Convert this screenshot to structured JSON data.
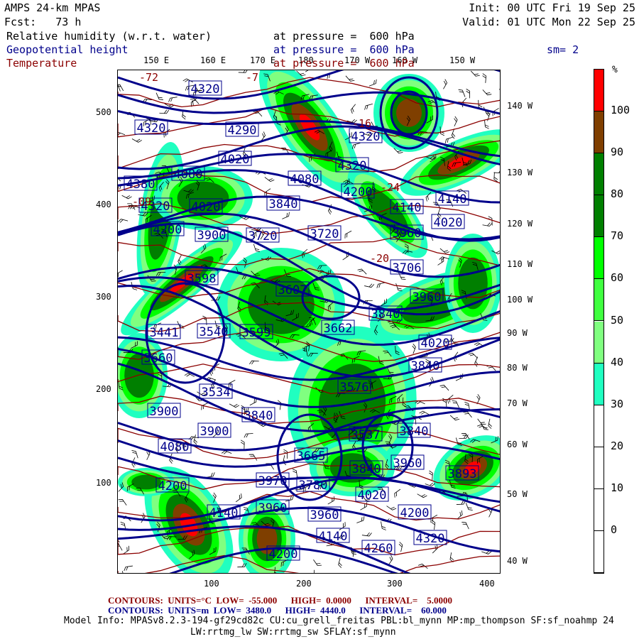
{
  "header": {
    "model": "AMPS 24-km MPAS",
    "fcst": "Fcst:   73 h",
    "init": "Init: 00 UTC Fri 19 Sep 25",
    "valid": "Valid: 01 UTC Mon 22 Sep 25",
    "field1": "Relative humidity (w.r.t. water)",
    "field1_level": "at pressure =  600 hPa",
    "field2": "Geopotential height",
    "field2_level": "at pressure =  600 hPa",
    "smoothing": "sm= 2",
    "field3": "Temperature",
    "field3_level": "at pressure =  600 hPa"
  },
  "map": {
    "top_lon_labels": [
      "150 E",
      "160 E",
      "170 E",
      "180",
      "170 W",
      "160 W",
      "150 W"
    ],
    "right_lon_labels": [
      "140 W",
      "130 W",
      "120 W",
      "110 W",
      "100 W",
      "90 W",
      "80 W",
      "70 W",
      "60 W",
      "50 W",
      "40 W"
    ],
    "x_ticks": [
      "100",
      "200",
      "300",
      "400"
    ],
    "y_ticks": [
      "500",
      "400",
      "300",
      "200",
      "100"
    ],
    "height_labels": [
      "4320",
      "4320",
      "4290",
      "4020",
      "4080",
      "4380",
      "4320",
      "4020",
      "4200",
      "3900",
      "3720",
      "4080",
      "3840",
      "4320",
      "4320",
      "4200",
      "4140",
      "4140",
      "4020",
      "3960",
      "3720",
      "3706",
      "3960",
      "3840",
      "3607",
      "3598",
      "3441",
      "3540",
      "3599",
      "3662",
      "4020",
      "3660",
      "3840",
      "3534",
      "3576",
      "3900",
      "3840",
      "3900",
      "4080",
      "3537",
      "3840",
      "3665",
      "3840",
      "3960",
      "3893",
      "4200",
      "3970",
      "3780",
      "4020",
      "4140",
      "3960",
      "3960",
      "4200",
      "4140",
      "4260",
      "4320",
      "4200"
    ],
    "temp_labels": [
      "-72",
      "-7",
      "-16",
      "-24",
      "-20",
      "-09"
    ]
  },
  "colorbar": {
    "unit": "%",
    "labels": [
      "100",
      "90",
      "80",
      "70",
      "60",
      "50",
      "40",
      "30",
      "20",
      "10",
      "0"
    ],
    "colors": [
      "#ff0000",
      "#7f3f00",
      "#007f00",
      "#007f00",
      "#00ff00",
      "#40ff40",
      "#80ff80",
      "#20ffc0",
      "#ffffff",
      "#ffffff",
      "#ffffff",
      "#ffffff"
    ]
  },
  "footer": {
    "temp_contours": "CONTOURS:  UNITS=°C  LOW=  -55.000      HIGH=  0.0000      INTERVAL=    5.0000",
    "height_contours": "CONTOURS:  UNITS=m  LOW=  3480.0      HIGH=  4440.0      INTERVAL=    60.000",
    "model_info": "Model Info: MPASv8.2.3-194-gf29cd82c CU:cu_grell_freitas PBL:bl_mynn MP:mp_thompson SF:sf_noahmp 24",
    "model_info2": "LW:rrtmg_lw SW:rrtmg_sw SFLAY:sf_mynn"
  }
}
